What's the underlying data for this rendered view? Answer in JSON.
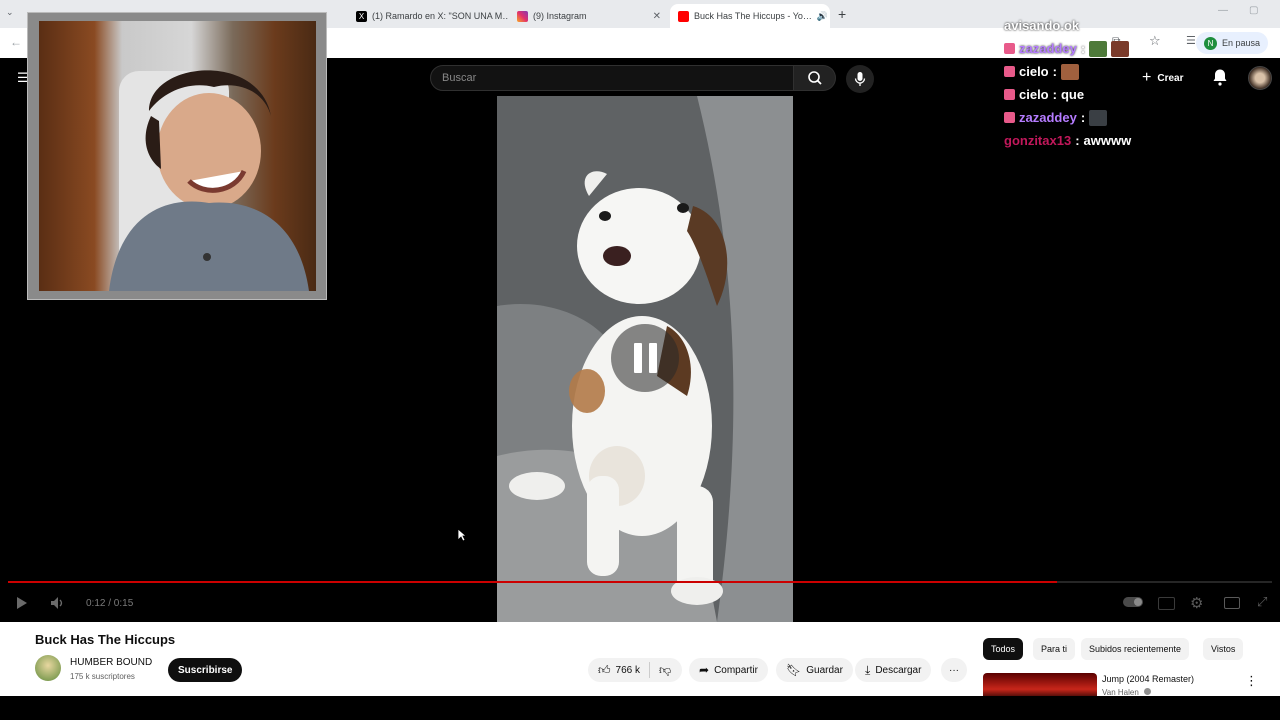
{
  "browser": {
    "tabs": [
      {
        "label": "(1) Ramardo en X: \"SON UNA M…",
        "icon": "x-logo-icon"
      },
      {
        "label": "(9) Instagram",
        "icon": "instagram-icon"
      },
      {
        "label": "Buck Has The Hiccups - Yo…",
        "icon": "youtube-icon",
        "active": true
      }
    ],
    "new_tab": "+",
    "profile_initial": "N",
    "profile_status": "En pausa"
  },
  "header": {
    "search_placeholder": "Buscar",
    "create_label": "Crear"
  },
  "player": {
    "time": "0:12 / 0:15",
    "progress": 0.83,
    "state": "paused-overlay"
  },
  "chat": {
    "lines": [
      {
        "user": "avisando.ok",
        "text": "",
        "color": "#ffffff",
        "badge": false,
        "emotes": 0
      },
      {
        "user": "zazaddey",
        "text": "",
        "color": "#b57cff",
        "badge": true,
        "emotes": 2
      },
      {
        "user": "cielo",
        "text": "",
        "color": "#ffffff",
        "badge": true,
        "emotes": 1
      },
      {
        "user": "cielo",
        "text": "que",
        "color": "#ffffff",
        "badge": true,
        "emotes": 0
      },
      {
        "user": "zazaddey",
        "text": "",
        "color": "#b57cff",
        "badge": true,
        "emotes": 1
      },
      {
        "user": "gonzitax13",
        "text": "awwww",
        "color": "#c2185b",
        "badge": false,
        "emotes": 0
      }
    ]
  },
  "video": {
    "title": "Buck Has The Hiccups",
    "channel": "HUMBER BOUND",
    "subscribers": "175 k suscriptores",
    "subscribe_label": "Suscribirse",
    "likes": "766 k",
    "share_label": "Compartir",
    "save_label": "Guardar",
    "download_label": "Descargar",
    "more_label": "···"
  },
  "sidebar": {
    "chips": [
      "Todos",
      "Para ti",
      "Subidos recientemente",
      "Vistos"
    ],
    "related": {
      "title": "Jump (2004 Remaster)",
      "channel": "Van Halen"
    }
  },
  "colors": {
    "accent": "#cc0000",
    "chip_active": "#0f0f0f"
  }
}
